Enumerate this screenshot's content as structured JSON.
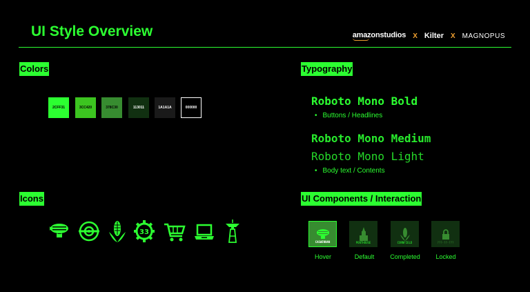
{
  "header": {
    "title": "UI Style Overview",
    "brands": {
      "amazon": "amazonstudios",
      "sep1": "X",
      "kilter": "Kilter",
      "sep2": "X",
      "magnopus": "MAGNOPUS"
    }
  },
  "sections": {
    "colors": "Colors",
    "typography": "Typography",
    "icons": "Icons",
    "components": "UI Components / Interaction"
  },
  "swatches": [
    {
      "hex": "2CFF31",
      "color": "#2CFF31"
    },
    {
      "hex": "3CC420",
      "color": "#3CC420"
    },
    {
      "hex": "378C30",
      "color": "#378C30"
    },
    {
      "hex": "113011",
      "color": "#113011"
    },
    {
      "hex": "1A1A1A",
      "color": "#1A1A1A"
    },
    {
      "hex": "000000",
      "color": "#000000"
    }
  ],
  "typography": {
    "bold": "Roboto Mono Bold",
    "bold_use": "Buttons / Headlines",
    "medium": "Roboto Mono Medium",
    "light": "Roboto Mono Light",
    "body_use": "Body text / Contents"
  },
  "icons": [
    "airship-icon",
    "portal-icon",
    "corn-icon",
    "gear-33-icon",
    "cart-icon",
    "laptop-icon",
    "space-needle-icon"
  ],
  "gear_number": "33",
  "components": [
    {
      "label": "CASWENNAN",
      "caption": "Hover"
    },
    {
      "label": "PENTHOUSE",
      "caption": "Default"
    },
    {
      "label": "CORNFIELD",
      "caption": "Completed"
    },
    {
      "label": "???-??-???",
      "caption": "Locked"
    }
  ],
  "colors": {
    "accent": "#2CFF31",
    "dark_green": "#113011",
    "mid_green": "#378C30",
    "bg": "#000000"
  }
}
